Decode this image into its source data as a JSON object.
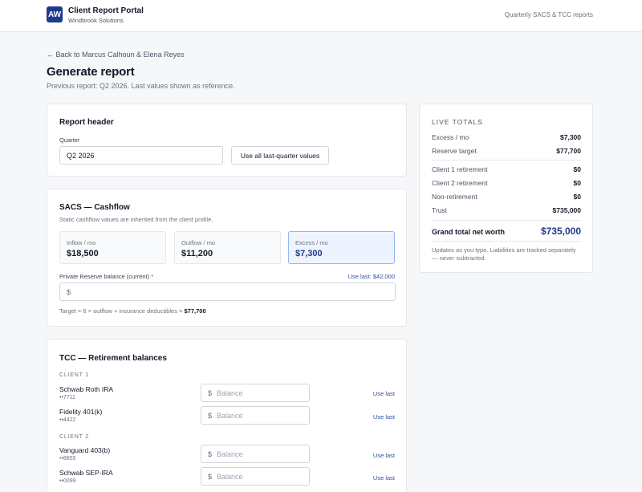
{
  "header": {
    "logo_text": "AW",
    "title": "Client Report Portal",
    "subtitle": "Windbrook Solutions",
    "right_text": "Quarterly SACS & TCC reports"
  },
  "page": {
    "back_link": "← Back to Marcus Calhoun & Elena Reyes",
    "title": "Generate report",
    "subtitle": "Previous report: Q2 2026. Last values shown as reference."
  },
  "report_header": {
    "title": "Report header",
    "quarter_label": "Quarter",
    "quarter_value": "Q2 2026",
    "use_all_button": "Use all last-quarter values"
  },
  "sacs": {
    "title": "SACS — Cashflow",
    "subtitle": "Static cashflow values are inherited from the client profile.",
    "stats": [
      {
        "label": "Inflow / mo",
        "value": "$18,500"
      },
      {
        "label": "Outflow / mo",
        "value": "$11,200"
      },
      {
        "label": "Excess / mo",
        "value": "$7,300"
      }
    ],
    "reserve_label": "Private Reserve balance (current)",
    "required_mark": "*",
    "use_last": "Use last: $42,000",
    "reserve_prefix": "$",
    "target_text": "Target = 6 × outflow + insurance deductibles = ",
    "target_value": "$77,700"
  },
  "tcc": {
    "title": "TCC — Retirement balances",
    "currency_prefix": "$",
    "balance_placeholder": "Balance",
    "use_last_label": "Use last",
    "clients": [
      {
        "label": "CLIENT 1",
        "accounts": [
          {
            "name": "Schwab Roth IRA",
            "number": "••7711"
          },
          {
            "name": "Fidelity 401(k)",
            "number": "••4422"
          }
        ]
      },
      {
        "label": "CLIENT 2",
        "accounts": [
          {
            "name": "Vanguard 403(b)",
            "number": "••8855"
          },
          {
            "name": "Schwab SEP-IRA",
            "number": "••0099"
          }
        ]
      }
    ]
  },
  "totals": {
    "heading": "LIVE TOTALS",
    "rows_top": [
      {
        "label": "Excess / mo",
        "value": "$7,300"
      },
      {
        "label": "Reserve target",
        "value": "$77,700"
      }
    ],
    "rows_mid": [
      {
        "label": "Client 1 retirement",
        "value": "$0"
      },
      {
        "label": "Client 2 retirement",
        "value": "$0"
      },
      {
        "label": "Non-retirement",
        "value": "$0"
      },
      {
        "label": "Trust",
        "value": "$735,000"
      }
    ],
    "grand_label": "Grand total net worth",
    "grand_value": "$735,000",
    "note": "Updates as you type. Liabilities are tracked separately — never subtracted."
  },
  "colors": {
    "brand": "#1e3a8a",
    "link": "#2f4f9e",
    "highlight_bg": "#eef4ff",
    "required": "#dc2626"
  }
}
